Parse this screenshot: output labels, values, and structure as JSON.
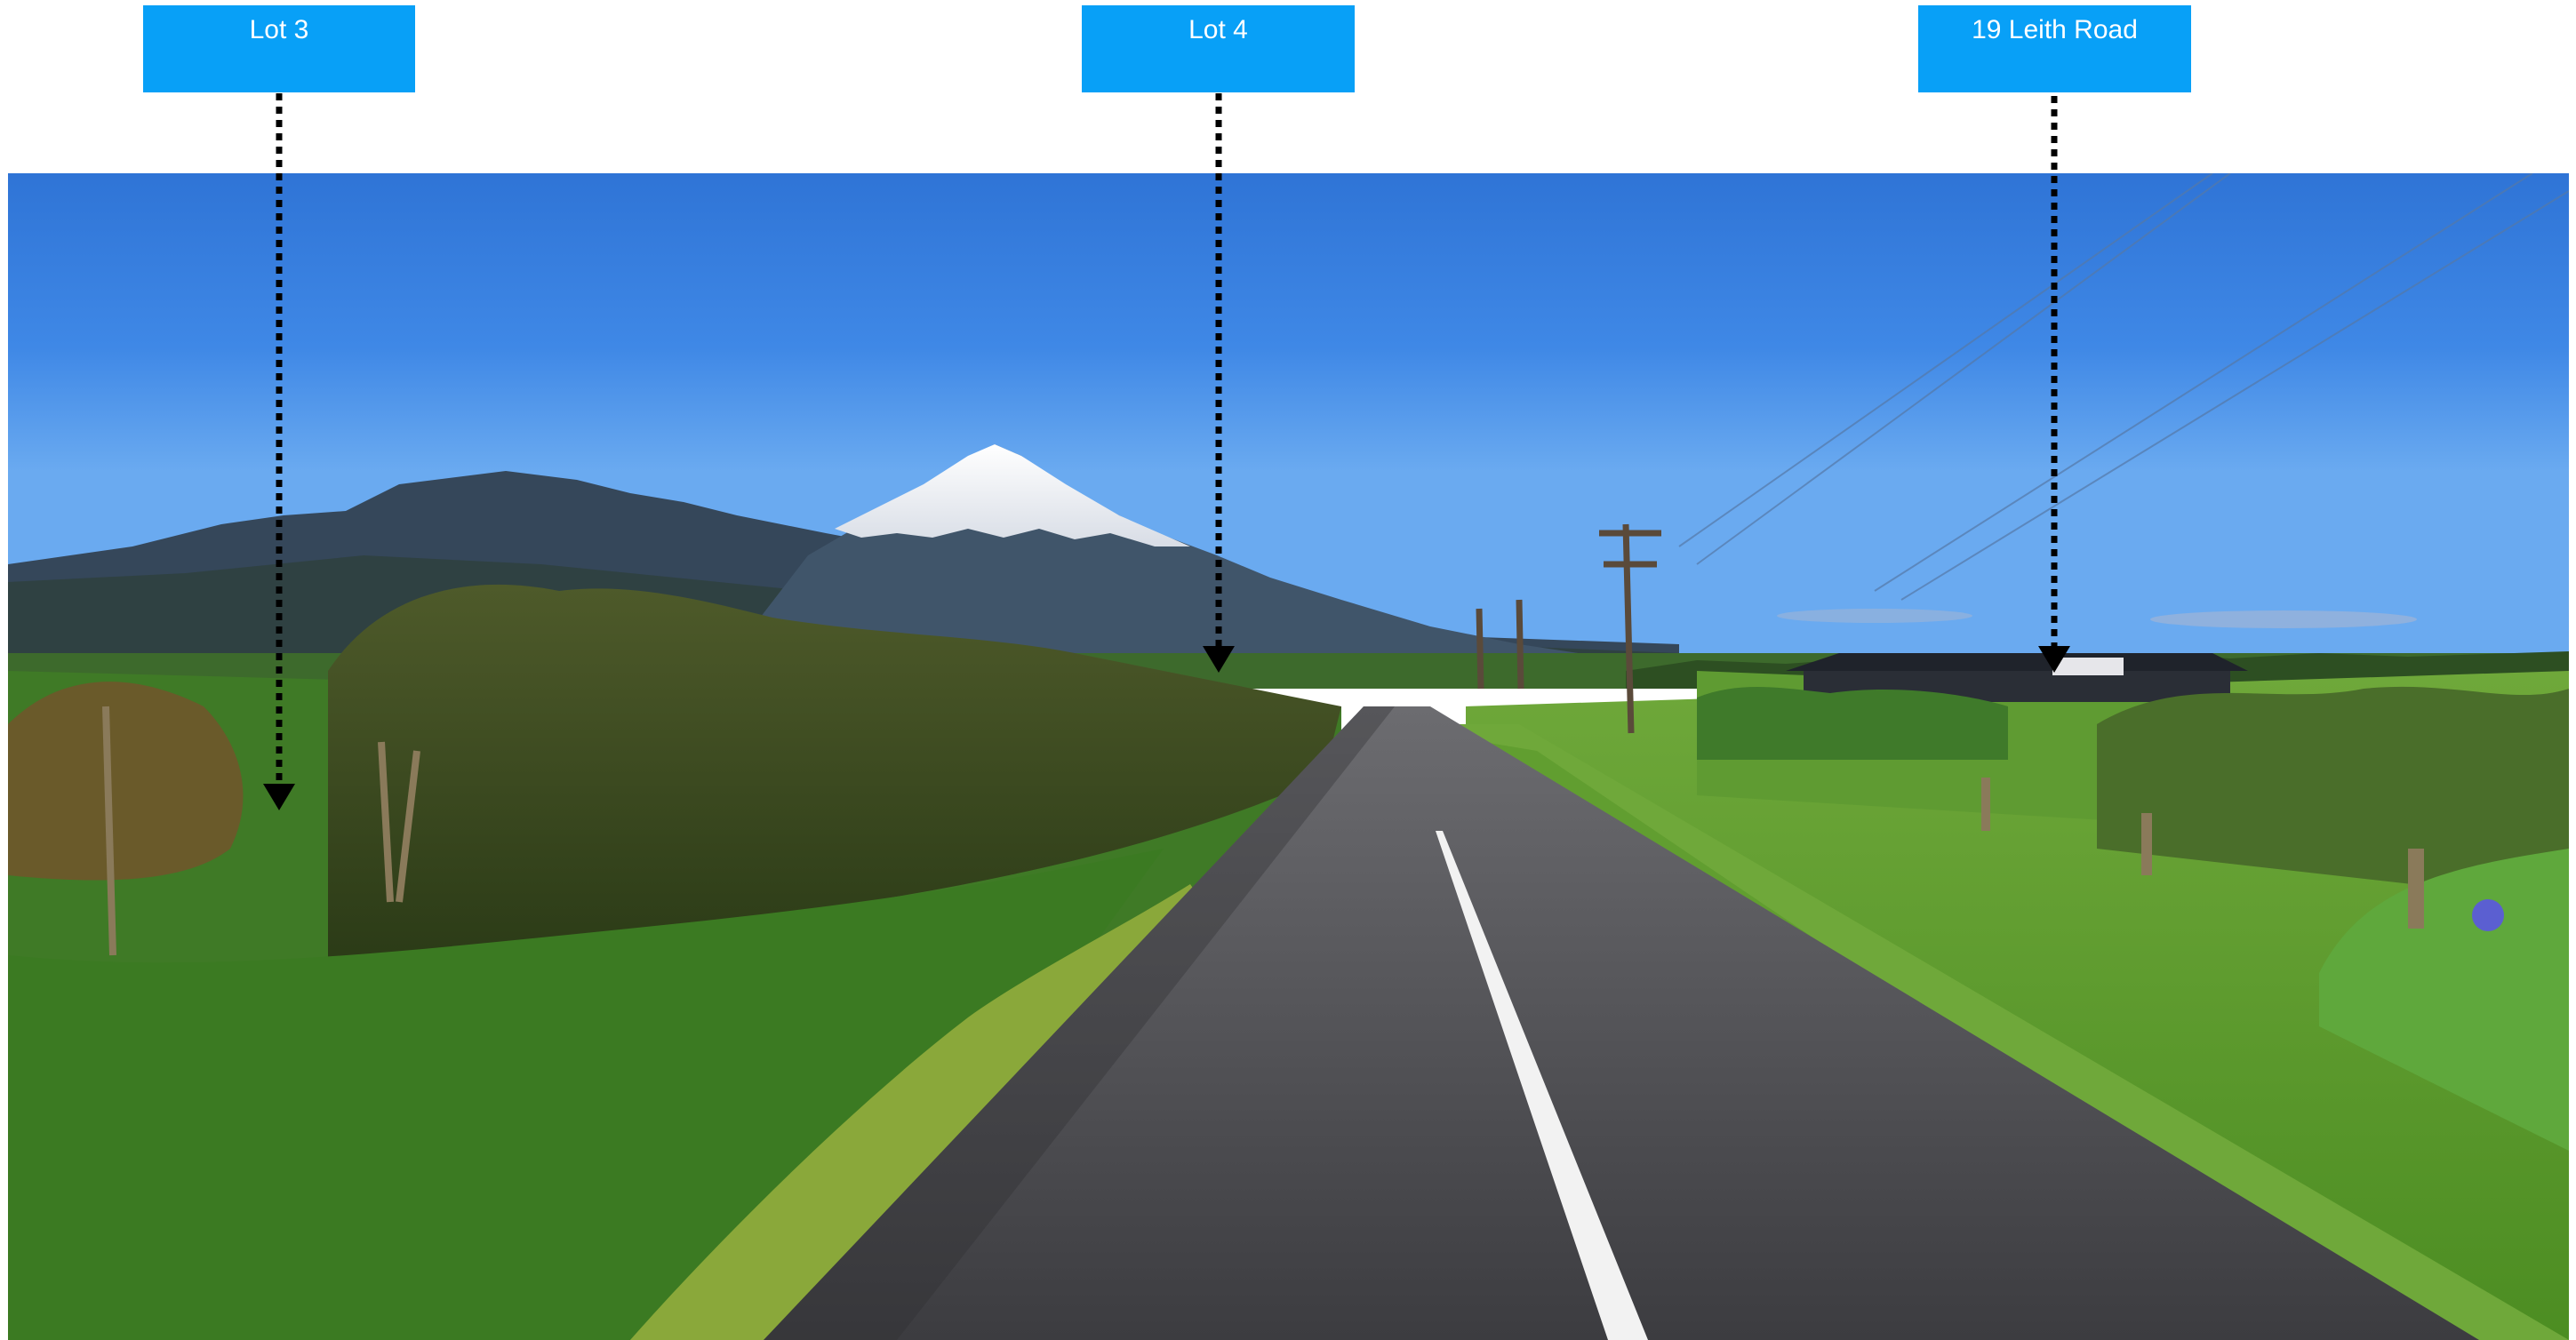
{
  "labels": {
    "lot3": "Lot 3",
    "lot4": "Lot 4",
    "leith": "19 Leith Road"
  },
  "colors": {
    "label_bg": "#08a0f7",
    "label_text": "#ffffff",
    "pointer": "#000000"
  },
  "photo": {
    "description_icon": "road-landscape-with-snow-capped-mountain"
  }
}
